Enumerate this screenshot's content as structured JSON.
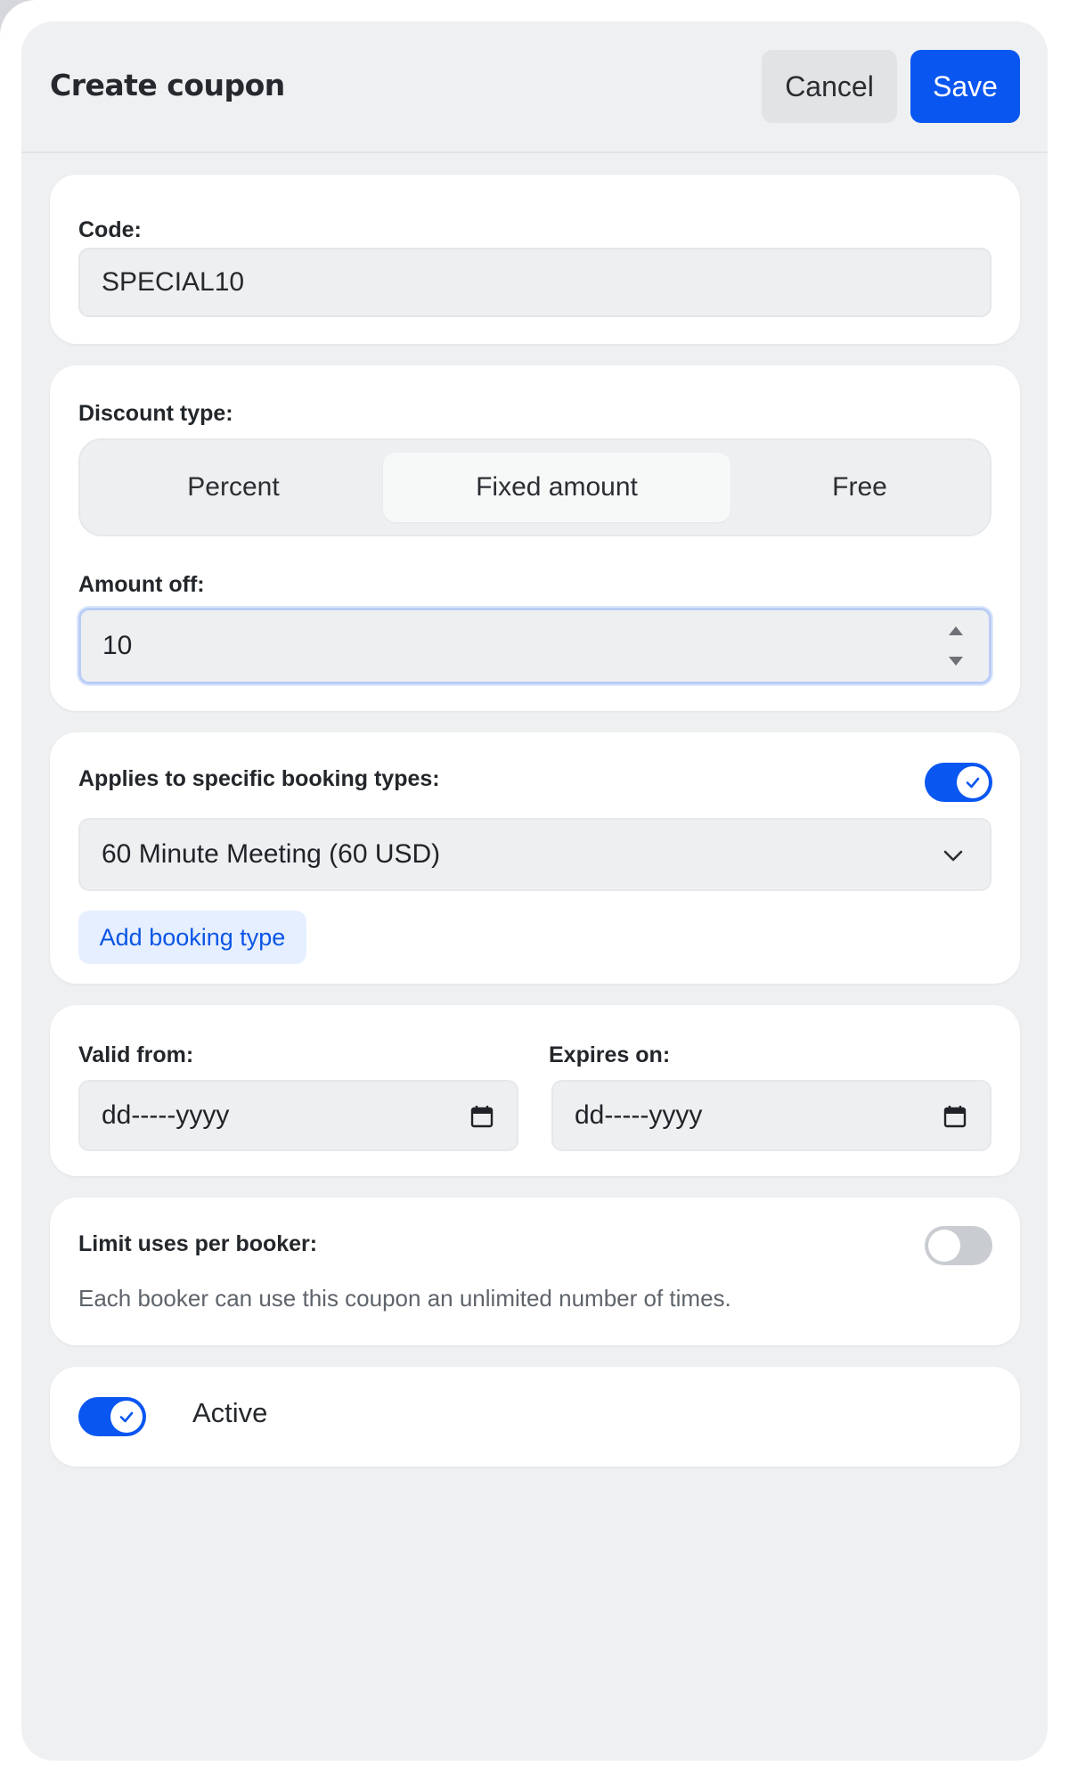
{
  "header": {
    "title": "Create coupon",
    "cancel_label": "Cancel",
    "save_label": "Save"
  },
  "code": {
    "label": "Code:",
    "value": "SPECIAL10"
  },
  "discount": {
    "label": "Discount type:",
    "options": [
      "Percent",
      "Fixed amount",
      "Free"
    ],
    "selected": "Fixed amount",
    "amount_label": "Amount off:",
    "amount_value": "10"
  },
  "booking_types": {
    "label": "Applies to specific booking types:",
    "enabled": true,
    "selected": "60 Minute Meeting (60 USD)",
    "add_label": "Add booking type"
  },
  "validity": {
    "from_label": "Valid from:",
    "from_value": "dd-----yyyy",
    "expires_label": "Expires on:",
    "expires_value": "dd-----yyyy"
  },
  "limit": {
    "label": "Limit uses per booker:",
    "enabled": false,
    "help": "Each booker can use this coupon an unlimited number of times."
  },
  "active": {
    "label": "Active",
    "enabled": true
  },
  "colors": {
    "accent": "#0a56f0",
    "panel_bg": "#eff0f2",
    "card_bg": "#ffffff",
    "toggle_off": "#c9ccd1"
  },
  "icons": [
    "check-icon",
    "chevron-down-icon",
    "calendar-icon",
    "stepper-icon"
  ]
}
